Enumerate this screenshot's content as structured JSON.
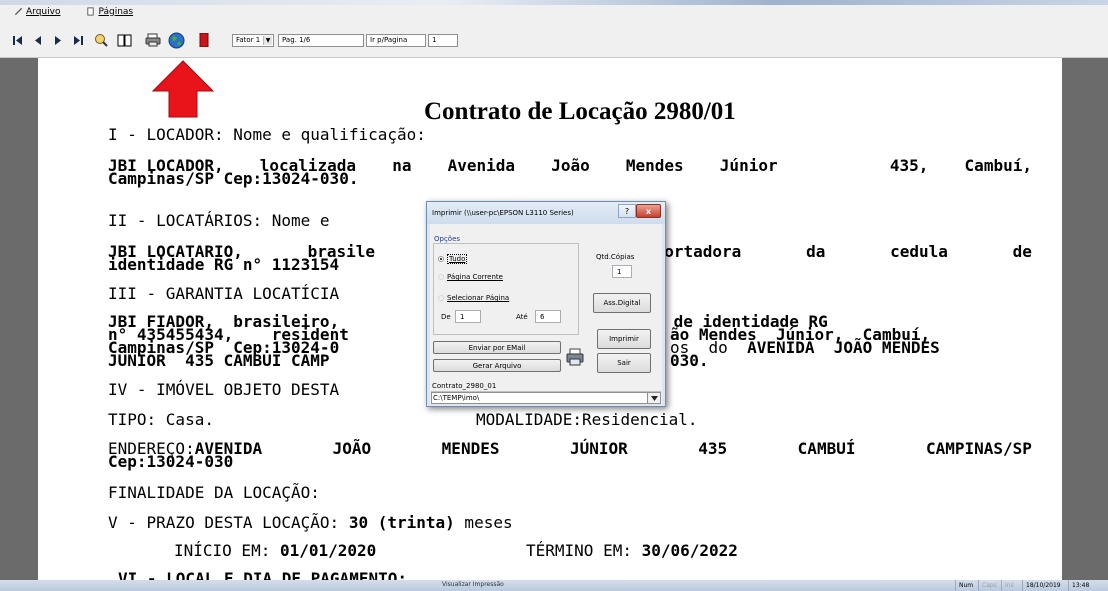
{
  "menu": {
    "items": [
      {
        "label": "Arquivo"
      },
      {
        "label": "Páginas"
      }
    ]
  },
  "toolbar": {
    "fator_value": "Fator 1",
    "page_label": "Pag. 1/6",
    "go_to_page_label": "Ir p/Pagina",
    "go_to_page_value": "1"
  },
  "document": {
    "title": "Contrato de Locação 2980/01",
    "lines": {
      "l1": "I - LOCADOR: Nome e qualificação:",
      "l2_words": [
        "JBI LOCADOR,",
        "localizada",
        "na",
        "Avenida",
        "João",
        "Mendes",
        "Júnior",
        "",
        "435,",
        "Cambuí,"
      ],
      "l3": "Campinas/SP Cep:13024-030.",
      "l4": "II - LOCATÁRIOS: Nome e",
      "l5_words": [
        "JBI LOCATARIO,",
        "brasile",
        "",
        "",
        "",
        "portadora",
        "da",
        "cedula",
        "de"
      ],
      "l6": "identidade RG n° 1123154",
      "l7": "III - GARANTIA LOCATÍCIA",
      "l8_words": [
        "JBI FIADOR,",
        "brasileiro,",
        "",
        "",
        "",
        "",
        "a da cedula de identidade RG"
      ],
      "l9_words": [
        "n° 435455434,",
        "resident",
        "",
        "",
        "ão",
        "Mendes",
        "Júnior,",
        "Cambuí,"
      ],
      "l10_words": [
        "Campinas/SP",
        "Cep:13024-0",
        "",
        "",
        "os",
        "do",
        "AVENIDA",
        "JOÃO MENDES"
      ],
      "l11": "JUNIOR  435 CAMBUI CAMP",
      "l11_tail": "030.",
      "l12": "IV - IMÓVEL OBJETO DESTA",
      "l13_a": "TIPO: Casa.",
      "l13_b": "MODALIDADE:Residencial.",
      "l14_prefix": "ENDEREÇO:",
      "l14_words": [
        "AVENIDA",
        "JOÃO",
        "MENDES",
        "JÚNIOR",
        "435",
        "CAMBUÍ",
        "CAMPINAS/SP"
      ],
      "l15": "Cep:13024-030",
      "l16": "FINALIDADE DA LOCAÇÃO:",
      "l17_a": "V - PRAZO DESTA LOCAÇÃO: ",
      "l17_b": "30 (trinta)",
      "l17_c": " meses",
      "l18_a": "INÍCIO EM: ",
      "l18_b": "01/01/2020",
      "l18_c": "TÉRMINO EM: ",
      "l18_d": "30/06/2022",
      "l19": "VI - LOCAL E DIA DE PAGAMENTO:"
    }
  },
  "dialog": {
    "title": "Imprimir (\\\\user-pc\\EPSON L3110 Series)",
    "help": "?",
    "close": "x",
    "group_label": "Opções",
    "radio_all": "Tudo",
    "radio_current": "Página Corrente",
    "radio_select": "Selecionar Página",
    "from_label": "De",
    "from_value": "1",
    "to_label": "Até",
    "to_value": "6",
    "copies_label": "Qtd.Cópias",
    "copies_value": "1",
    "sign_button": "Ass.Digital",
    "print_button": "Imprimir",
    "email_button": "Enviar por EMail",
    "file_button": "Gerar Arquivo",
    "exit_button": "Sair",
    "file_name": "Contrato_2980_01",
    "folder_path": "C:\\TEMP\\imo\\"
  },
  "statusbar": {
    "center": "Visualizar Impressão",
    "num": "Num",
    "caps": "Caps",
    "ins": "Ins",
    "date": "18/10/2019",
    "time": "13:48"
  },
  "colors": {
    "arrow": "#e8141a",
    "close_button": "#c4412d",
    "group_label": "#1f3f8f"
  }
}
